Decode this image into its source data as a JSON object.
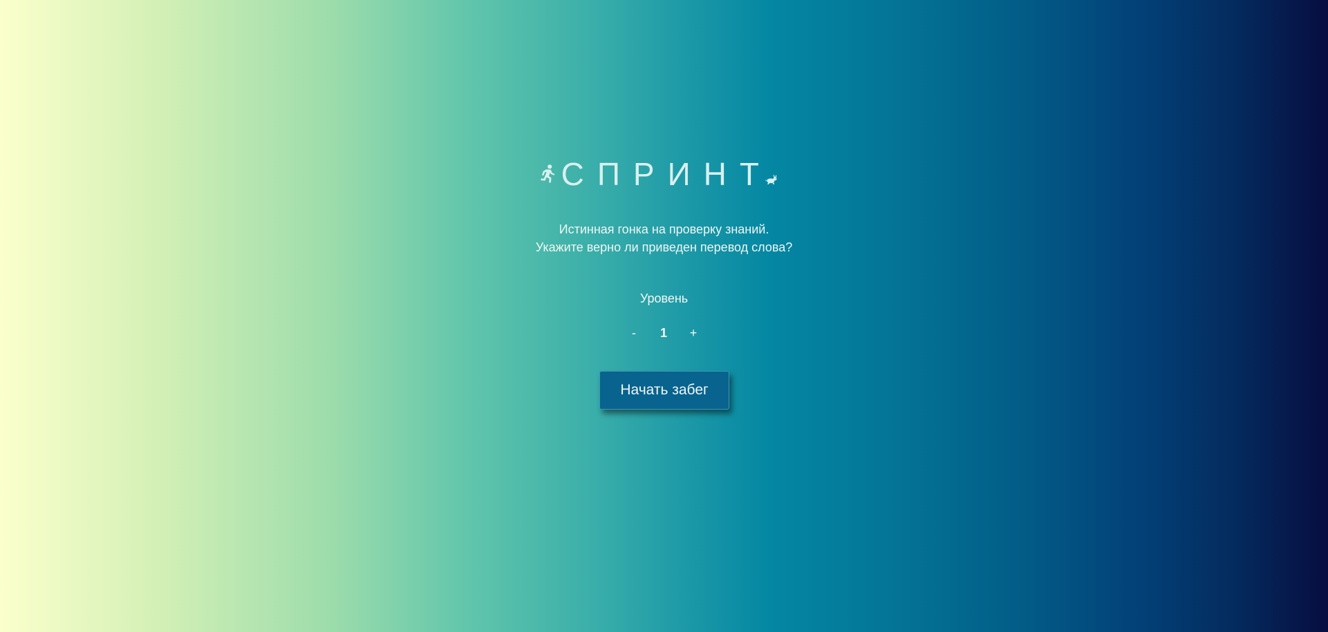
{
  "header": {
    "title": "СПРИНТ",
    "left_icon": "running-person-icon",
    "right_icon": "rabbit-icon"
  },
  "description": {
    "line1": "Истинная гонка на проверку знаний.",
    "line2": "Укажите верно ли приведен перевод слова?"
  },
  "level": {
    "label": "Уровень",
    "decrement_label": "-",
    "value": "1",
    "increment_label": "+"
  },
  "start_button": {
    "label": "Начать забег",
    "color": "#08638e"
  },
  "colors": {
    "gradient_start": "#fbffcc",
    "gradient_mid": "#0487a3",
    "gradient_end": "#070d40",
    "title_color": "#d9f0ee"
  }
}
